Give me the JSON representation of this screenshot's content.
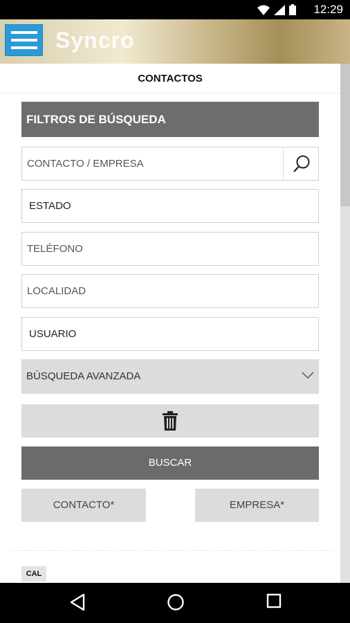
{
  "status_bar": {
    "time": "12:29",
    "icons": [
      "wifi-icon",
      "signal-icon",
      "battery-icon"
    ]
  },
  "app_bar": {
    "brand": "Syncro",
    "menu_icon": "hamburger-menu-icon"
  },
  "page": {
    "title": "CONTACTOS"
  },
  "filters": {
    "header": "FILTROS DE BÚSQUEDA",
    "search_placeholder": "CONTACTO / EMPRESA",
    "estado_label": "ESTADO",
    "telefono_placeholder": "TELÉFONO",
    "localidad_placeholder": "LOCALIDAD",
    "usuario_label": "USUARIO",
    "advanced_label": "BÚSQUEDA AVANZADA",
    "search_button": "BUSCAR",
    "contacto_button": "CONTACTO*",
    "empresa_button": "EMPRESA*"
  },
  "list": {
    "first_badge": "CAL"
  },
  "colors": {
    "accent": "#2c9ad8",
    "header_gray": "#6d6d6d",
    "button_gray": "#dcdcdc"
  }
}
